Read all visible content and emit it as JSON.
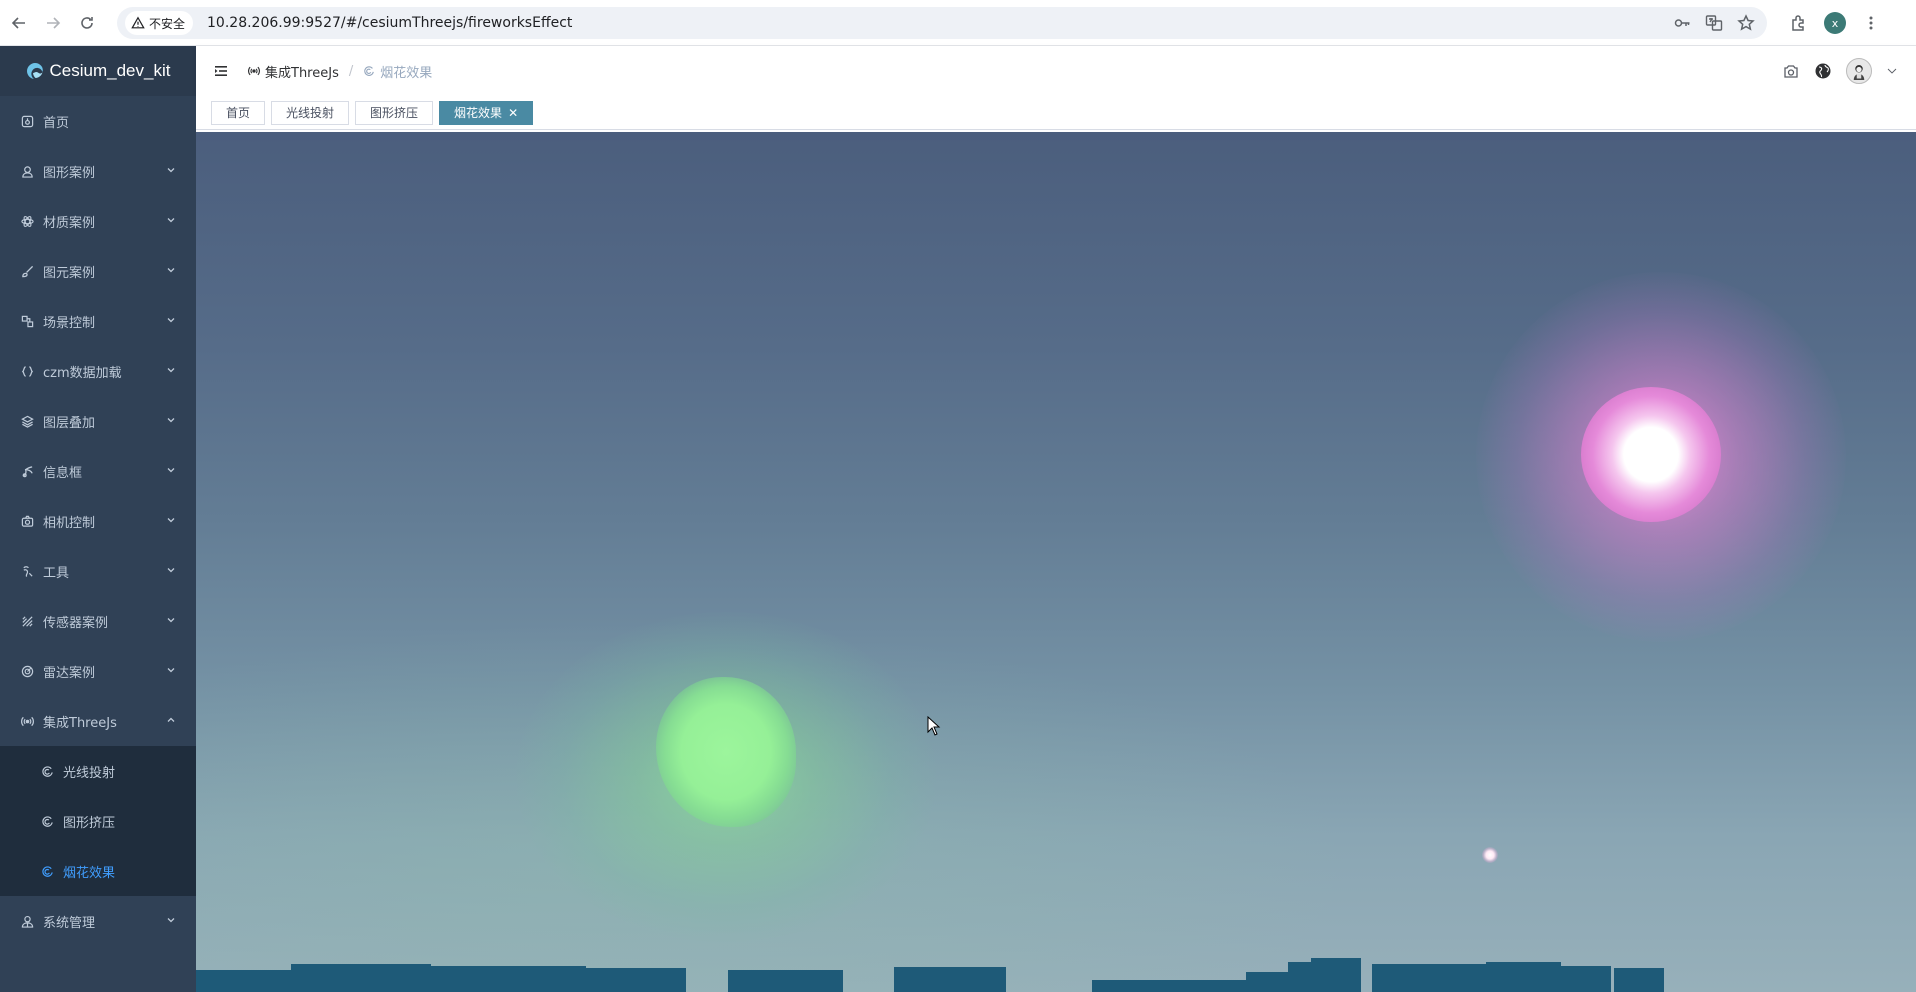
{
  "browser": {
    "security_label": "不安全",
    "url": "10.28.206.99:9527/#/cesiumThreejs/fireworksEffect",
    "profile_initial": "x"
  },
  "sidebar": {
    "logo_text": "Cesium_dev_kit",
    "items": [
      {
        "label": "首页",
        "icon": "dashboard-icon"
      },
      {
        "label": "图形案例",
        "icon": "user-icon"
      },
      {
        "label": "材质案例",
        "icon": "atom-icon"
      },
      {
        "label": "图元案例",
        "icon": "brush-icon"
      },
      {
        "label": "场景控制",
        "icon": "scene-icon"
      },
      {
        "label": "czm数据加载",
        "icon": "braces-icon"
      },
      {
        "label": "图层叠加",
        "icon": "layers-icon"
      },
      {
        "label": "信息框",
        "icon": "infobox-icon"
      },
      {
        "label": "相机控制",
        "icon": "camera-icon"
      },
      {
        "label": "工具",
        "icon": "tool-icon"
      },
      {
        "label": "传感器案例",
        "icon": "sensor-icon"
      },
      {
        "label": "雷达案例",
        "icon": "radar-icon"
      },
      {
        "label": "集成ThreeJs",
        "icon": "broadcast-icon"
      }
    ],
    "submenu": [
      {
        "label": "光线投射",
        "icon": "swirl-icon"
      },
      {
        "label": "图形挤压",
        "icon": "swirl-icon"
      },
      {
        "label": "烟花效果",
        "icon": "swirl-icon",
        "active": true
      }
    ],
    "last_item": {
      "label": "系统管理",
      "icon": "admin-icon"
    }
  },
  "breadcrumb": {
    "parent": "集成ThreeJs",
    "current": "烟花效果"
  },
  "tags": [
    {
      "label": "首页"
    },
    {
      "label": "光线投射"
    },
    {
      "label": "图形挤压"
    },
    {
      "label": "烟花效果",
      "active": true,
      "close": "✕"
    }
  ],
  "colors": {
    "sidebar_bg": "#304156",
    "submenu_bg": "#1f2d3d",
    "active_text": "#409eff",
    "active_tag": "#4a8aa3"
  }
}
